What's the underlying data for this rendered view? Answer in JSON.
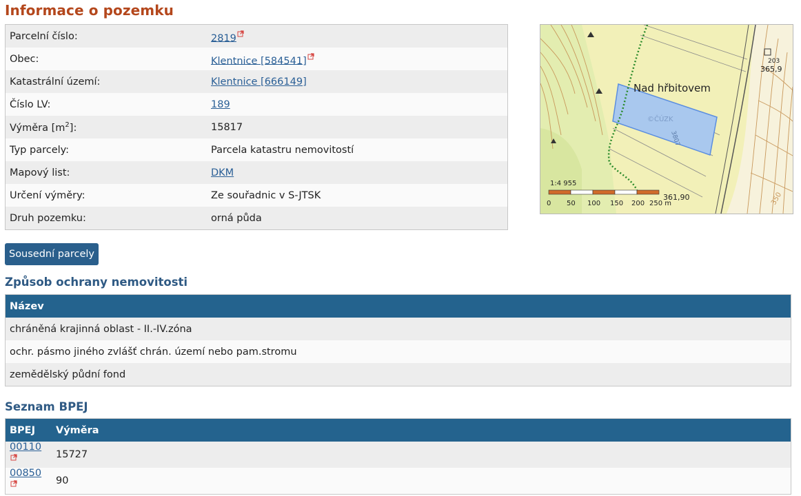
{
  "page": {
    "title": "Informace o pozemku"
  },
  "parcel_info": {
    "rows": [
      {
        "label": "Parcelní číslo:",
        "value": "2819",
        "link": true,
        "external": true
      },
      {
        "label": "Obec:",
        "value": "Klentnice [584541]",
        "link": true,
        "external": true
      },
      {
        "label": "Katastrální území:",
        "value": "Klentnice [666149]",
        "link": true,
        "external": false
      },
      {
        "label": "Číslo LV:",
        "value": "189",
        "link": true,
        "external": false
      },
      {
        "label_prefix": "Výměra [m",
        "label_sup": "2",
        "label_suffix": "]:",
        "value": "15817",
        "link": false,
        "external": false
      },
      {
        "label": "Typ parcely:",
        "value": "Parcela katastru nemovitostí",
        "link": false,
        "external": false
      },
      {
        "label": "Mapový list:",
        "value": "DKM",
        "link": true,
        "external": false
      },
      {
        "label": "Určení výměry:",
        "value": "Ze souřadnic v S-JTSK",
        "link": false,
        "external": false
      },
      {
        "label": "Druh pozemku:",
        "value": "orná půda",
        "link": false,
        "external": false
      }
    ]
  },
  "map": {
    "place_label": "Nad hřbitovem",
    "scale_ratio": "1:4 955",
    "scale_ticks": [
      "0",
      "50",
      "100",
      "150",
      "200",
      "250 m"
    ],
    "elevation_1_num": "203",
    "elevation_1": "365,9",
    "elevation_2": "361,90",
    "contour_label": "350",
    "parcel_label": "3807",
    "watermark": "©ČÚZK",
    "colors": {
      "background": "#f2f0b8",
      "parcel_fill": "#a9c8ee",
      "parcel_border": "#5a8de0",
      "contour": "#c8975a",
      "path": "#2a8a2a"
    }
  },
  "neighbours_button": {
    "label": "Sousední parcely"
  },
  "protection": {
    "title": "Způsob ochrany nemovitosti",
    "header": "Název",
    "rows": [
      "chráněná krajinná oblast - II.-IV.zóna",
      "ochr. pásmo jiného zvlášť chrán. území nebo pam.stromu",
      "zemědělský půdní fond"
    ]
  },
  "bpej": {
    "title": "Seznam BPEJ",
    "headers": [
      "BPEJ",
      "Výměra"
    ],
    "rows": [
      {
        "code": "00110",
        "area": "15727"
      },
      {
        "code": "00850",
        "area": "90"
      }
    ]
  },
  "colors": {
    "title": "#b4471c",
    "section_title": "#2f5a84",
    "table_header": "#24638e",
    "button": "#2a5f8c",
    "link": "#2a5f96"
  }
}
